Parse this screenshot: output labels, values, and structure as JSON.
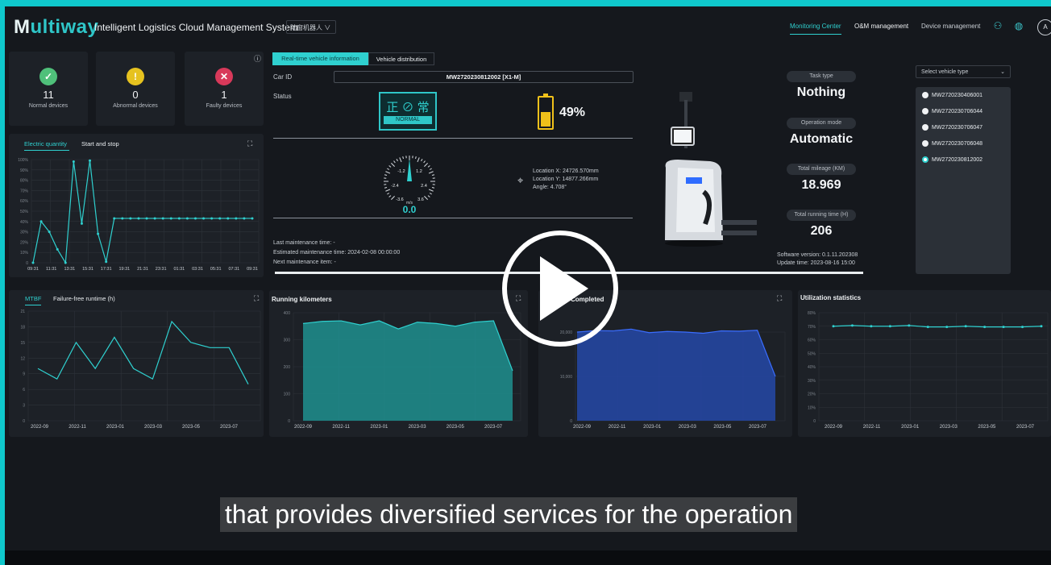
{
  "header": {
    "logo_main": "Multiway",
    "logo_prefix": "M",
    "logo_rest": "ultiway",
    "system_title": "Intelligent Logistics Cloud Management System",
    "robot_select": "陆窗机器人 ∨",
    "nav": [
      "Monitoring Center",
      "O&M management",
      "Device management"
    ],
    "avatar": "A"
  },
  "stats": [
    {
      "count": "11",
      "label": "Normal devices",
      "color": "#4fc07a",
      "icon": "check-icon"
    },
    {
      "count": "0",
      "label": "Abnormal devices",
      "color": "#e6c21f",
      "icon": "alert-icon"
    },
    {
      "count": "1",
      "label": "Faulty devices",
      "color": "#d8395a",
      "icon": "wrench-icon"
    }
  ],
  "electric": {
    "tabs": [
      "Electric quantity",
      "Start and stop"
    ],
    "yticks": [
      "100%",
      "90%",
      "80%",
      "70%",
      "60%",
      "50%",
      "40%",
      "30%",
      "20%",
      "10%",
      "0"
    ],
    "xticks": [
      "09:31",
      "11:31",
      "13:31",
      "15:31",
      "17:31",
      "19:31",
      "21:31",
      "23:31",
      "01:31",
      "03:31",
      "05:31",
      "07:31",
      "09:31"
    ],
    "values": [
      0,
      40,
      30,
      13,
      0,
      98,
      38,
      99,
      28,
      1,
      43,
      43,
      43,
      43,
      43,
      43,
      43,
      43,
      43,
      43,
      43,
      43,
      43,
      43,
      43,
      43,
      43,
      43
    ]
  },
  "vehicle": {
    "tabs": [
      "Real-time vehicle information",
      "Vehicle distribution"
    ],
    "car_id_label": "Car ID",
    "car_id": "MW2720230812002 [X1-M]",
    "status_label": "Status",
    "status_cn": "正 ⊘ 常",
    "status_en": "NORMAL",
    "battery": "49%",
    "battery_level": 0.49,
    "gauge": {
      "ticks": [
        "-1.2",
        "1.2",
        "-2.4",
        "2.4",
        "-3.6",
        "3.6"
      ],
      "unit": "m/s",
      "value": "0.0"
    },
    "location": [
      "Location X: 24726.570mm",
      "Location Y: 14877.266mm",
      "Angle: 4.708°"
    ],
    "maintenance": [
      "Last maintenance time: -",
      "Estimated maintenance time: 2024-02-08 00:00:00",
      "Next maintenance item: -"
    ],
    "task_type_label": "Task type",
    "task_type": "Nothing",
    "mode_label": "Operation mode",
    "mode": "Automatic",
    "mileage_label": "Total mileage (KM)",
    "mileage": "18.969",
    "runtime_label": "Total running time (H)",
    "runtime": "206",
    "software": "Software version: 0.1.11.202308",
    "update": "Update time: 2023-08-16 15:00"
  },
  "vehicle_list": {
    "placeholder": "Select vehicle type",
    "items": [
      "MW2720230406001",
      "MW2720230706044",
      "MW2720230706047",
      "MW2720230706048",
      "MW2720230812002"
    ],
    "selected": 4
  },
  "charts": {
    "months": [
      "2022-09",
      "2022-11",
      "2023-01",
      "2023-03",
      "2023-05",
      "2023-07"
    ],
    "mtbf": {
      "tabs": [
        "MTBF",
        "Failure-free runtime (h)"
      ],
      "yticks": [
        "21",
        "18",
        "15",
        "12",
        "9",
        "6",
        "3",
        "0"
      ],
      "values": [
        10,
        8,
        15,
        10,
        16,
        10,
        8,
        19,
        15,
        14,
        14,
        7
      ]
    },
    "km": {
      "title": "Running kilometers",
      "yticks": [
        "400",
        "300",
        "200",
        "100",
        "0"
      ],
      "values": [
        360,
        368,
        370,
        355,
        370,
        340,
        365,
        360,
        350,
        365,
        370,
        185
      ]
    },
    "completed": {
      "title": "Completed",
      "yticks": [
        "20,000",
        "10,000",
        "0"
      ],
      "values": [
        30000,
        30500,
        30400,
        31000,
        29800,
        30200,
        30000,
        29600,
        30400,
        30300,
        30600,
        15000
      ]
    },
    "util": {
      "title": "Utilization statistics",
      "yticks": [
        "80%",
        "70%",
        "60%",
        "50%",
        "40%",
        "30%",
        "20%",
        "10%",
        "0"
      ],
      "values": [
        70,
        70.5,
        70,
        70,
        70.5,
        69.5,
        69.5,
        70,
        69.5,
        69.5,
        69.5,
        70
      ]
    }
  },
  "caption": "that provides diversified services for the operation"
}
